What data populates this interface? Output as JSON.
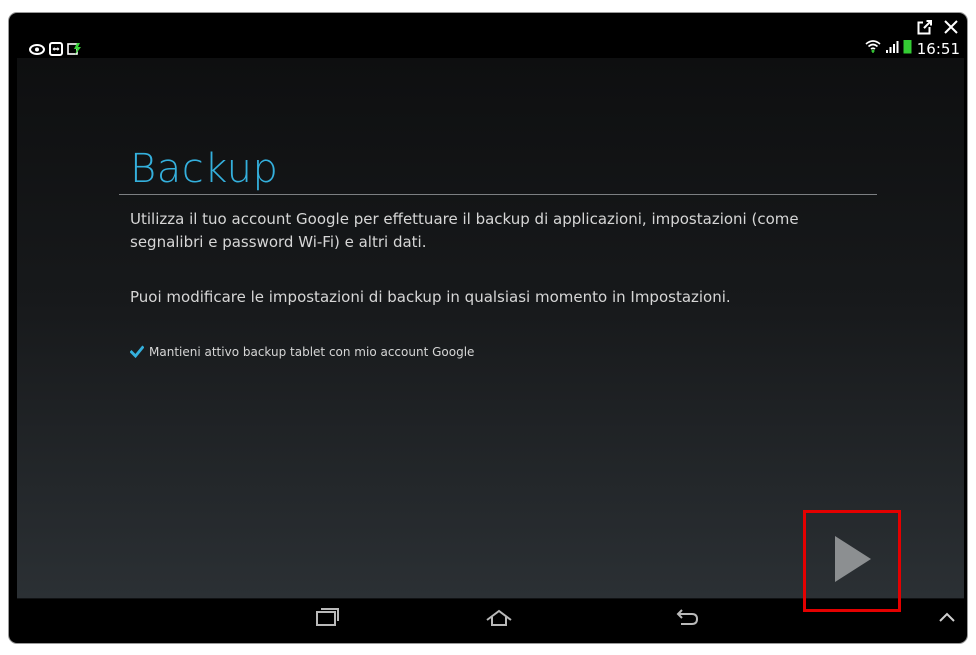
{
  "window": {
    "controls": [
      "popout-icon",
      "close-icon"
    ]
  },
  "statusbar": {
    "left_icons": [
      "eye-icon",
      "teamviewer-icon",
      "screen-share-icon"
    ],
    "right_icons": [
      "wifi-icon",
      "signal-icon",
      "battery-icon"
    ],
    "time": "16:51",
    "battery_color": "#33cc33"
  },
  "page": {
    "title": "Backup",
    "paragraph1": "Utilizza il tuo account Google per effettuare il backup di applicazioni, impostazioni (come segnalibri e password Wi-Fi) e altri dati.",
    "paragraph2": "Puoi modificare le impostazioni di backup in qualsiasi momento in Impostazioni.",
    "checkbox_label": "Mantieni attivo backup tablet con mio account Google",
    "checkbox_checked": true,
    "accent_color": "#34b0dd",
    "highlight_color": "#e40000"
  },
  "navbar": {
    "buttons": [
      "recent-apps-icon",
      "home-icon",
      "back-icon",
      "chevron-up-icon"
    ]
  }
}
